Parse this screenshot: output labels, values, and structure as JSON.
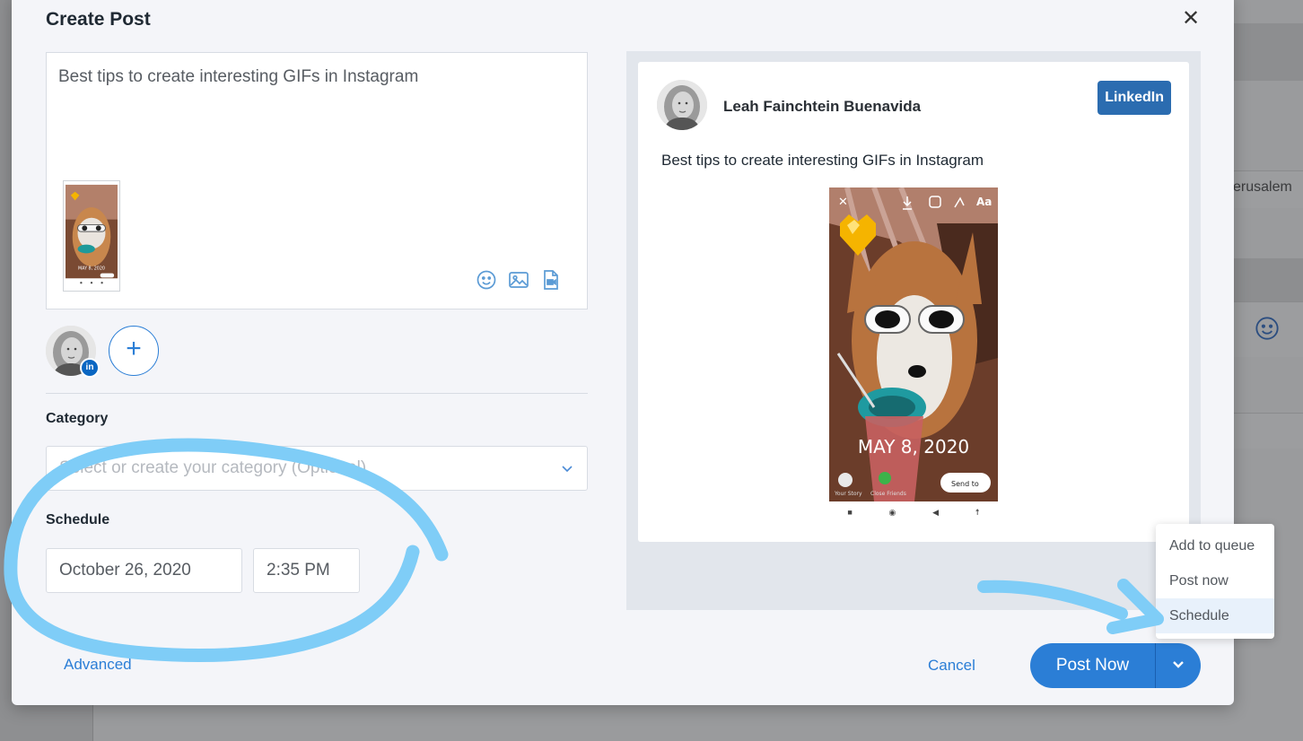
{
  "background": {
    "partial_text": "erusalem",
    "smiley_icon": "smiley-icon"
  },
  "modal": {
    "title": "Create Post",
    "close_icon": "close-icon",
    "editor": {
      "text": "Best tips to create interesting GIFs in Instagram",
      "thumbnail_date": "MAY 8, 2020",
      "tools": [
        "emoji-icon",
        "image-icon",
        "video-file-icon"
      ]
    },
    "accounts": {
      "network_badge": "in",
      "add_icon": "+"
    },
    "category": {
      "label": "Category",
      "placeholder": "Select or create your category (Optional)"
    },
    "schedule": {
      "label": "Schedule",
      "date": "October 26, 2020",
      "time": "2:35 PM"
    },
    "footer": {
      "advanced": "Advanced",
      "cancel": "Cancel",
      "post_now": "Post Now"
    }
  },
  "preview": {
    "author": "Leah Fainchtein Buenavida",
    "network": "LinkedIn",
    "text": "Best tips to create interesting GIFs in Instagram",
    "image": {
      "date_overlay": "MAY 8, 2020",
      "top_label": "Aa",
      "send_to": "Send to",
      "your_story": "Your Story",
      "close_friends": "Close Friends"
    }
  },
  "dropdown_menu": {
    "items": [
      "Add to queue",
      "Post now",
      "Schedule"
    ],
    "highlighted": "Schedule"
  },
  "colors": {
    "accent": "#2b7ed6",
    "annotation": "#7fcdf7",
    "linkedin": "#2b6cb0"
  }
}
